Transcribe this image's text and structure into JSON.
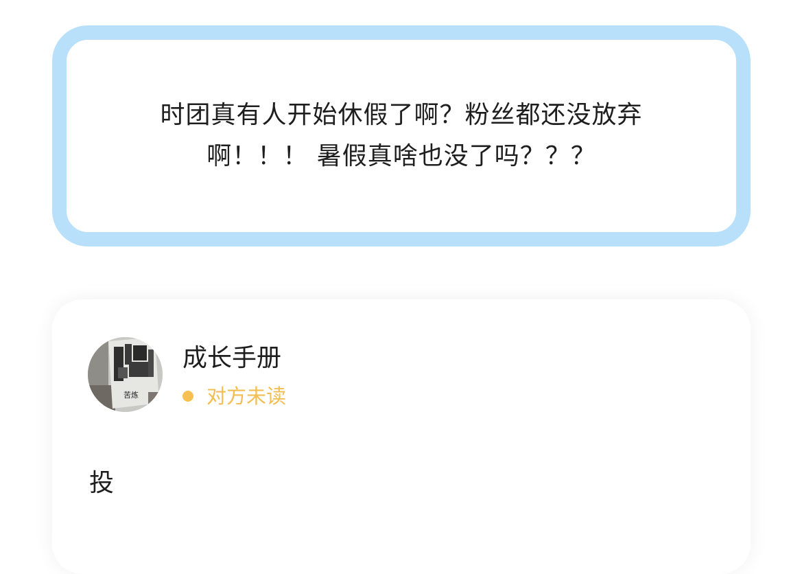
{
  "question": {
    "line1": "时团真有人开始休假了啊？粉丝都还没放弃",
    "line2": "啊！！！ 暑假真啥也没了吗？？？"
  },
  "reply": {
    "username": "成长手册",
    "status": "对方未读",
    "text": "投",
    "avatar_book_title": "苦炼",
    "status_color": "#f2bd51",
    "card_border_color": "#b9e0fb"
  }
}
